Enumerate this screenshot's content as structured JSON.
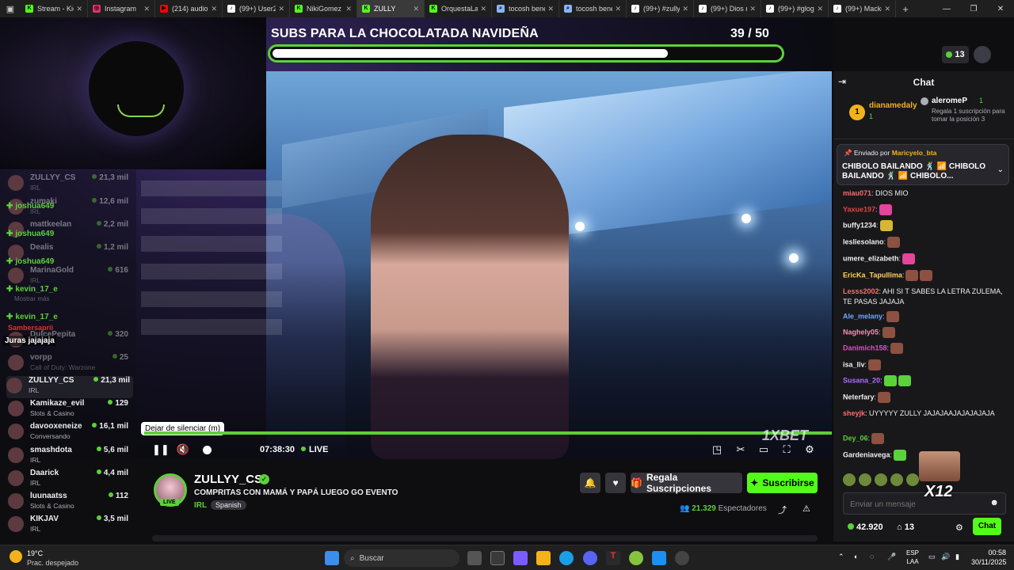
{
  "browser": {
    "tabs": [
      {
        "label": "Stream - Kic",
        "fav": "K",
        "color": "#53fc18"
      },
      {
        "label": "Instagram",
        "fav": "◎",
        "color": "#e1306c"
      },
      {
        "label": "(214) audio",
        "fav": "▶",
        "color": "#ff0000"
      },
      {
        "label": "(99+) User2",
        "fav": "♪",
        "color": "#ffffff"
      },
      {
        "label": "NikiGomez",
        "fav": "K",
        "color": "#53fc18"
      },
      {
        "label": "ZULLY",
        "fav": "K",
        "color": "#53fc18"
      },
      {
        "label": "OrquestaLal",
        "fav": "K",
        "color": "#53fc18"
      },
      {
        "label": "tocosh bene",
        "fav": "⌕",
        "color": "#8ab4f8"
      },
      {
        "label": "tocosh bene",
        "fav": "⌕",
        "color": "#8ab4f8"
      },
      {
        "label": "(99+) #zully",
        "fav": "♪",
        "color": "#ffffff"
      },
      {
        "label": "(99+) Dios m",
        "fav": "♪",
        "color": "#ffffff"
      },
      {
        "label": "(99+) #glogl",
        "fav": "♪",
        "color": "#ffffff"
      },
      {
        "label": "(99+) Macke",
        "fav": "♪",
        "color": "#ffffff"
      }
    ],
    "active_tab_index": 5,
    "new_tab": "+",
    "window_controls": [
      "—",
      "❐",
      "✕"
    ]
  },
  "overlay": {
    "goal_title": "SUBS PARA LA CHOCOLATADA NAVIDEÑA",
    "goal_count": "39  / 50",
    "goal_progress": 0.78
  },
  "chat_overlay": {
    "names": [
      "joshua649",
      "joshua649",
      "joshua649",
      "kevin_17_e",
      "kevin_17_e"
    ],
    "sambersaprii": "Sambersaprii",
    "juras": "Juras jajajaja",
    "mostrar_mas": "Mostrar más"
  },
  "channels": [
    {
      "name": "ZULLYY_CS",
      "game": "IRL",
      "viewers": "21,3 mil",
      "dim": true
    },
    {
      "name": "zumaki",
      "game": "IRL",
      "viewers": "12,6 mil",
      "dim": true
    },
    {
      "name": "mattkeelan",
      "game": "",
      "viewers": "2,2 mil",
      "dim": true
    },
    {
      "name": "Dealis",
      "game": "",
      "viewers": "1,2 mil",
      "dim": true
    },
    {
      "name": "MarinaGold",
      "game": "IRL",
      "viewers": "616",
      "dim": true
    },
    {
      "name": "DulcePepita",
      "game": "",
      "viewers": "320",
      "dim": true
    },
    {
      "name": "vorpp",
      "game": "Call of Duty: Warzone",
      "viewers": "25",
      "dim": true
    },
    {
      "name": "ZULLYY_CS",
      "game": "IRL",
      "viewers": "21,3 mil",
      "sel": true
    },
    {
      "name": "Kamikaze_evil",
      "game": "Slots & Casino",
      "viewers": "129"
    },
    {
      "name": "davooxeneize",
      "game": "Conversando",
      "viewers": "16,1 mil"
    },
    {
      "name": "smashdota",
      "game": "IRL",
      "viewers": "5,6 mil"
    },
    {
      "name": "Daarick",
      "game": "IRL",
      "viewers": "4,4 mil"
    },
    {
      "name": "luunaatss",
      "game": "Slots & Casino",
      "viewers": "112"
    },
    {
      "name": "KIKJAV",
      "game": "IRL",
      "viewers": "3,5 mil"
    }
  ],
  "player": {
    "tooltip": "Dejar de silenciar (m)",
    "time": "07:38:30",
    "live": "LIVE",
    "brand": "1XBET",
    "icons": [
      "pause-icon",
      "unmute-icon",
      "pip-icon",
      "theater-icon",
      "minimize-icon",
      "fullscreen-icon",
      "settings-icon"
    ]
  },
  "stream": {
    "name": "ZULLYY_CS",
    "title": "COMPRITAS CON MAMÁ Y PAPÁ LUEGO GO EVENTO",
    "category": "IRL",
    "language": "Spanish",
    "live_badge": "LIVE",
    "viewers": "21.329",
    "viewers_label": "Espectadores",
    "gift_label": "Regala Suscripciones",
    "subscribe_label": "Suscribirse"
  },
  "right_top": {
    "viewers": "13"
  },
  "chat": {
    "header": "Chat",
    "top_gifter": {
      "rank": "1",
      "name": "dianamedaly",
      "count": "1"
    },
    "second": {
      "name": "aleromeP",
      "count": "1",
      "prompt": "Regala 1 suscripción para tomar la posición 3"
    },
    "pinned": {
      "by_label": "Enviado por",
      "by": "Maricyelo_bta",
      "text": "CHIBOLO BAILANDO 🕺 📶 CHIBOLO BAILANDO 🕺 📶 CHIBOLO..."
    },
    "messages": [
      {
        "user": "miau071",
        "color": "#ff6b6b",
        "text": ": DIOS MIO",
        "emotes": []
      },
      {
        "user": "Yaxue197",
        "color": "#e34242",
        "text": ":",
        "emotes": [
          "p"
        ]
      },
      {
        "user": "buffy1234",
        "color": "#efeff1",
        "text": ":",
        "emotes": [
          "y"
        ]
      },
      {
        "user": "lesliesolano",
        "color": "#efeff1",
        "text": ":",
        "emotes": [
          "b"
        ]
      },
      {
        "user": "umere_elizabeth",
        "color": "#efeff1",
        "text": ":",
        "emotes": [
          "p"
        ]
      },
      {
        "user": "EricKa_Tapullima",
        "color": "#ffd35b",
        "text": ":",
        "emotes": [
          "b",
          "b"
        ]
      },
      {
        "user": "Lesss2002",
        "color": "#ff6b6b",
        "text": ": AHI SI T SABES LA LETRA ZULEMA, TE PASAS JAJAJA",
        "emotes": []
      },
      {
        "user": "Ale_melany",
        "color": "#6fa8ff",
        "text": ":",
        "emotes": [
          "b"
        ]
      },
      {
        "user": "Naghely05",
        "color": "#ff8fb1",
        "text": ":",
        "emotes": [
          "b"
        ]
      },
      {
        "user": "Danimich158",
        "color": "#e34cc0",
        "text": ":",
        "emotes": [
          "b"
        ]
      },
      {
        "user": "isa_liv",
        "color": "#efeff1",
        "text": ":",
        "emotes": [
          "b"
        ]
      },
      {
        "user": "Susana_20",
        "color": "#b06cff",
        "text": ":",
        "emotes": [
          "g",
          "g"
        ]
      },
      {
        "user": "Neterfary",
        "color": "#efeff1",
        "text": ":",
        "emotes": [
          "b"
        ]
      },
      {
        "user": "sheyjk",
        "color": "#ff6b6b",
        "text": ": UYYYYY ZULLY JAJAJAAJAJAJAJAJA",
        "emotes": []
      },
      {
        "user": "Dey_06",
        "color": "#5bd13a",
        "text": ":",
        "emotes": [
          "b"
        ]
      },
      {
        "user": "Gardeniavega",
        "color": "#efeff1",
        "text": ":",
        "emotes": [
          "g"
        ]
      }
    ],
    "gift_multiplier": "X12",
    "input_placeholder": "Enviar un mensaje",
    "kicks": "42.920",
    "gifts": "13",
    "chat_button": "Chat"
  },
  "taskbar": {
    "temp": "19°C",
    "weather": "Prac. despejado",
    "search": "Buscar",
    "lang": "ESP",
    "lang2": "LAA",
    "time": "00:58",
    "date": "30/11/2025"
  }
}
